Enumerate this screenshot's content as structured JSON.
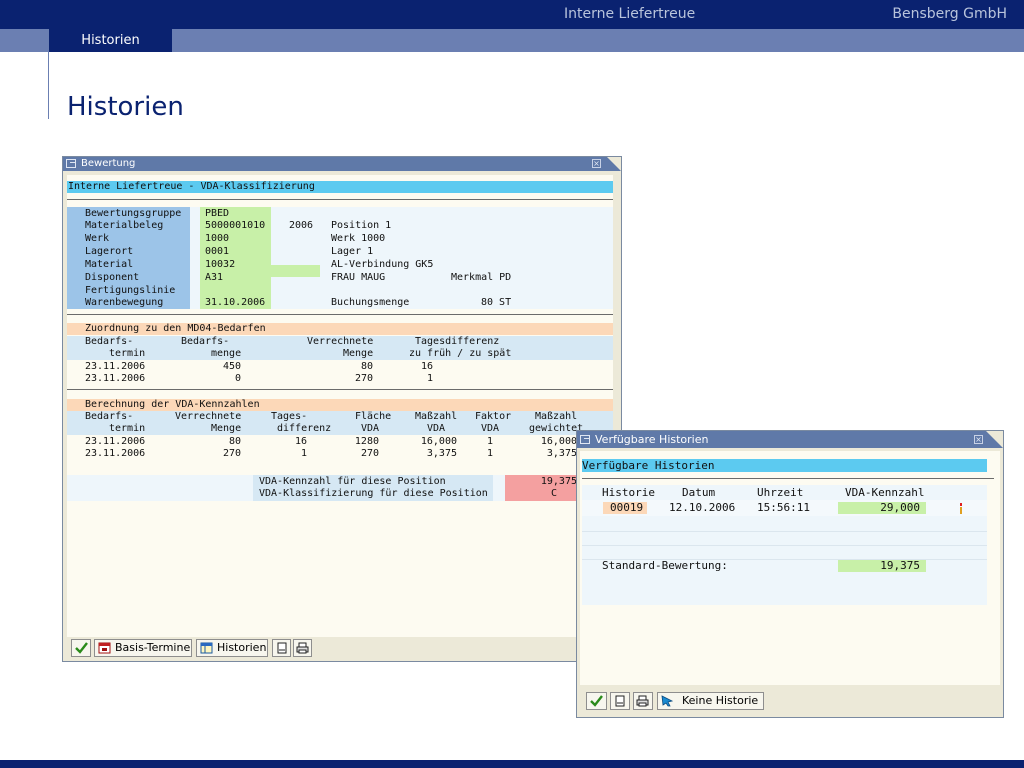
{
  "header": {
    "center_title": "Interne Liefertreue",
    "company": "Bensberg GmbH",
    "active_tab": "Historien",
    "page_title": "Historien"
  },
  "bewertung": {
    "window_title": "Bewertung",
    "heading": "Interne Liefertreue - VDA-Klassifizierung",
    "fields": [
      {
        "label": "Bewertungsgruppe",
        "value": "PBED"
      },
      {
        "label": "Materialbeleg",
        "value": "5000001010",
        "extra1": "2006",
        "extra2": "Position 1"
      },
      {
        "label": "Werk",
        "value": "1000",
        "extra2": "Werk 1000"
      },
      {
        "label": "Lagerort",
        "value": "0001",
        "extra2": "Lager 1"
      },
      {
        "label": "Material",
        "value": "10032",
        "extra2": "AL-Verbindung GK5"
      },
      {
        "label": "Disponent",
        "value": "A31",
        "extra2": "FRAU MAUG",
        "extra3": "Merkmal PD"
      },
      {
        "label": "Fertigungslinie",
        "value": ""
      },
      {
        "label": "Warenbewegung",
        "value": "31.10.2006",
        "extra2": "Buchungsmenge",
        "extra3": "80 ST"
      }
    ],
    "section1": {
      "title": "Zuordnung zu den MD04-Bedarfen",
      "headers": [
        "Bedarfs-",
        "termin",
        "Bedarfs-",
        "menge",
        "Verrechnete",
        "Menge",
        "Tagesdifferenz",
        "zu früh / zu spät"
      ],
      "rows": [
        [
          "23.11.2006",
          "450",
          "80",
          "16"
        ],
        [
          "23.11.2006",
          "0",
          "270",
          "1"
        ]
      ]
    },
    "section2": {
      "title": "Berechnung der VDA-Kennzahlen",
      "headers": [
        "Bedarfs-",
        "termin",
        "Verrechnete",
        "Menge",
        "Tages-",
        "differenz",
        "Fläche",
        "VDA",
        "Maßzahl",
        "VDA",
        "Faktor",
        "VDA",
        "Maßzahl",
        "gewichtet"
      ],
      "rows": [
        [
          "23.11.2006",
          "80",
          "16",
          "1280",
          "16,000",
          "1",
          "16,000"
        ],
        [
          "23.11.2006",
          "270",
          "1",
          "270",
          "3,375",
          "1",
          "3,375"
        ]
      ],
      "result_label_1": "VDA-Kennzahl für diese Position",
      "result_value_1": "19,375",
      "result_label_2": "VDA-Klassifizierung für diese Position",
      "result_value_2": "C"
    },
    "buttons": {
      "basis_termine": "Basis-Termine",
      "historien": "Historien"
    }
  },
  "historien": {
    "window_title": "Verfügbare Historien",
    "heading": "Verfügbare Historien",
    "headers": [
      "Historie",
      "Datum",
      "Uhrzeit",
      "VDA-Kennzahl"
    ],
    "row": {
      "historie": "00019",
      "datum": "12.10.2006",
      "uhrzeit": "15:56:11",
      "kennzahl": "29,000"
    },
    "standard_label": "Standard-Bewertung:",
    "standard_value": "19,375",
    "buttons": {
      "keine_historie": "Keine Historie"
    }
  },
  "colors": {
    "navy": "#0a2270",
    "label_blue": "#9cc4e8",
    "value_green": "#c8f0a8",
    "section_peach": "#fcd8b8",
    "result_red": "#f4a0a0",
    "heading_cyan": "#5ccaf0"
  }
}
